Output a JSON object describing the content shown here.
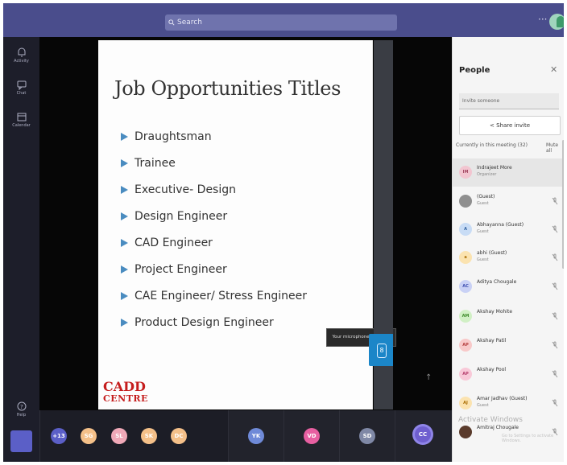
{
  "search": {
    "placeholder": "Search"
  },
  "header": {
    "more": "···"
  },
  "rail": {
    "items": [
      {
        "label": "Activity",
        "icon": "bell-icon"
      },
      {
        "label": "Chat",
        "icon": "chat-icon"
      },
      {
        "label": "Calendar",
        "icon": "calendar-icon"
      },
      {
        "label": "Help",
        "icon": "help-icon"
      }
    ]
  },
  "slide": {
    "title": "Job Opportunities Titles",
    "jobs": [
      "Draughtsman",
      "Trainee",
      "Executive- Design",
      "Design Engineer",
      "CAD Engineer",
      "Project Engineer",
      "CAE Engineer/ Stress Engineer",
      "Product Design Engineer"
    ],
    "logo_line1": "CADD",
    "logo_line2": "CENTRE"
  },
  "toast": "Your microphone is muted",
  "gutter": {
    "count": "8"
  },
  "participants_strip": [
    {
      "initials": "+13",
      "color": "#5b5fc7"
    },
    {
      "initials": "SG",
      "color": "#f4c089"
    },
    {
      "initials": "SL",
      "color": "#f0a9b8"
    },
    {
      "initials": "SK",
      "color": "#f4c089"
    },
    {
      "initials": "DC",
      "color": "#f4c089"
    },
    {
      "initials": "YK",
      "color": "#6f8ad8"
    },
    {
      "initials": "VD",
      "color": "#e75fa1"
    },
    {
      "initials": "SD",
      "color": "#7f88a6"
    },
    {
      "initials": "CC",
      "color": "#6f5fcf"
    }
  ],
  "people": {
    "title": "People",
    "invite_placeholder": "Invite someone",
    "share_label": "Share invite",
    "section_label": "Currently in this meeting (32)",
    "mute_all": "Mute all",
    "list": [
      {
        "initials": "IM",
        "name": "Indrajeet More",
        "role": "Organizer",
        "color": "#f2c5d0",
        "text": "#a14560"
      },
      {
        "initials": "",
        "name": "(Guest)",
        "role": "Guest",
        "color": "#8f8f8f",
        "text": "#fff"
      },
      {
        "initials": "A",
        "name": "Abhayanna (Guest)",
        "role": "Guest",
        "color": "#c8dcf5",
        "text": "#2d5f9e"
      },
      {
        "initials": "a",
        "name": "abhi (Guest)",
        "role": "Guest",
        "color": "#fbe3b0",
        "text": "#a86b00"
      },
      {
        "initials": "AC",
        "name": "Aditya Chougale",
        "role": "",
        "color": "#c9d1f5",
        "text": "#3d4db0"
      },
      {
        "initials": "AM",
        "name": "Akshay Mohite",
        "role": "",
        "color": "#d1f0c5",
        "text": "#3d8a2a"
      },
      {
        "initials": "AP",
        "name": "Akshay Patil",
        "role": "",
        "color": "#f8c9c9",
        "text": "#b33b3b"
      },
      {
        "initials": "AP",
        "name": "Akshay Pool",
        "role": "",
        "color": "#f8c9d8",
        "text": "#b33b6a"
      },
      {
        "initials": "AJ",
        "name": "Amar Jadhav (Guest)",
        "role": "Guest",
        "color": "#fbe3b0",
        "text": "#a86b00"
      },
      {
        "initials": "",
        "name": "Amitraj Chougale",
        "role": "",
        "color": "#5a3b2c",
        "text": "#fff"
      }
    ]
  },
  "watermark": {
    "line1": "Activate Windows",
    "line2": "Go to Settings to activate Windows."
  }
}
